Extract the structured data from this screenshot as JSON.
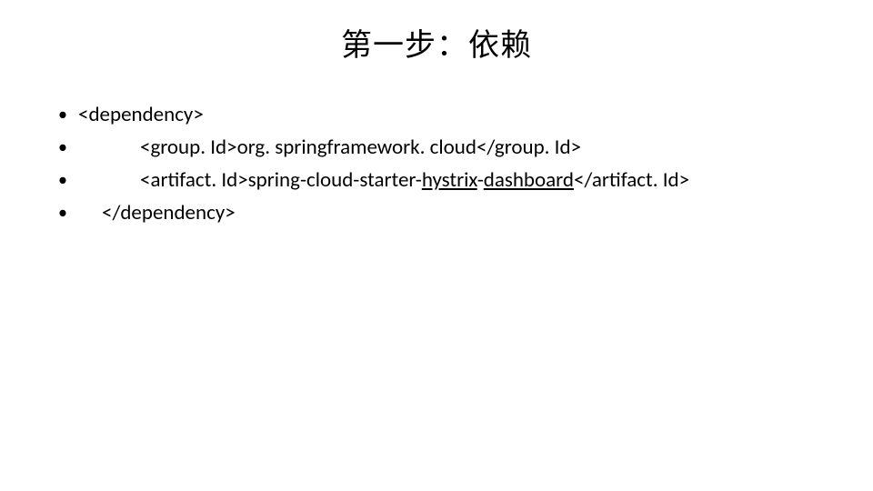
{
  "title": "第一步：依赖",
  "bullets": {
    "b1": "<dependency>",
    "b2_prefix": "<group. Id>org. springframework. cloud</group. Id>",
    "b3_plain1": "<artifact. Id>spring-cloud-starter-",
    "b3_u1": "hystrix",
    "b3_plain2": "-",
    "b3_u2": "dashboard",
    "b3_plain3": "</artifact. Id>",
    "b4": "</dependency>"
  }
}
